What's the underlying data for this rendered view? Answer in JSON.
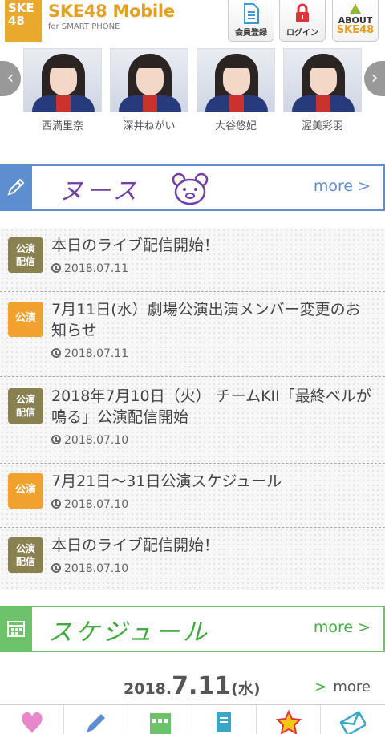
{
  "header": {
    "logo_lines": [
      "SKE",
      "48"
    ],
    "brand_title": "SKE48 Mobile",
    "brand_sub": "for SMART PHONE",
    "register_label": "会員登録",
    "login_label": "ログイン",
    "about_label": "ABOUT",
    "about_brand": "SKE48"
  },
  "members": [
    {
      "name": "西満里奈"
    },
    {
      "name": "深井ねがい"
    },
    {
      "name": "大谷悠妃"
    },
    {
      "name": "渥美彩羽"
    }
  ],
  "news_section": {
    "title": "ヌース",
    "more": "more >"
  },
  "news": [
    {
      "badge": "公演\n配信",
      "badge_color": "olive",
      "title": "本日のライブ配信開始！",
      "date": "2018.07.11"
    },
    {
      "badge": "公演",
      "badge_color": "orange",
      "title": "7月11日(水）劇場公演出演メンバー変更のお知らせ",
      "date": "2018.07.11"
    },
    {
      "badge": "公演\n配信",
      "badge_color": "olive",
      "title": "2018年7月10日（火） チームKII「最終ベルが鳴る」公演配信開始",
      "date": "2018.07.10"
    },
    {
      "badge": "公演",
      "badge_color": "orange",
      "title": "7月21日〜31日公演スケジュール",
      "date": "2018.07.10"
    },
    {
      "badge": "公演\n配信",
      "badge_color": "olive",
      "title": "本日のライブ配信開始！",
      "date": "2018.07.10"
    }
  ],
  "schedule_section": {
    "title": "スケジュール",
    "more": "more >"
  },
  "schedule": {
    "year_month": "2018.",
    "day": "7.11",
    "weekday": "(水)",
    "more_arrow": ">",
    "more": "more"
  },
  "colors": {
    "brand": "#e3a023",
    "news_accent": "#5d8ed0",
    "schedule_accent": "#6cc36a",
    "badge_olive": "#8a8150",
    "badge_orange": "#f0a12e"
  },
  "bottom_nav_icons": [
    "heart-icon",
    "pencil-icon",
    "calendar-icon",
    "document-icon",
    "star-icon",
    "mail-icon"
  ]
}
